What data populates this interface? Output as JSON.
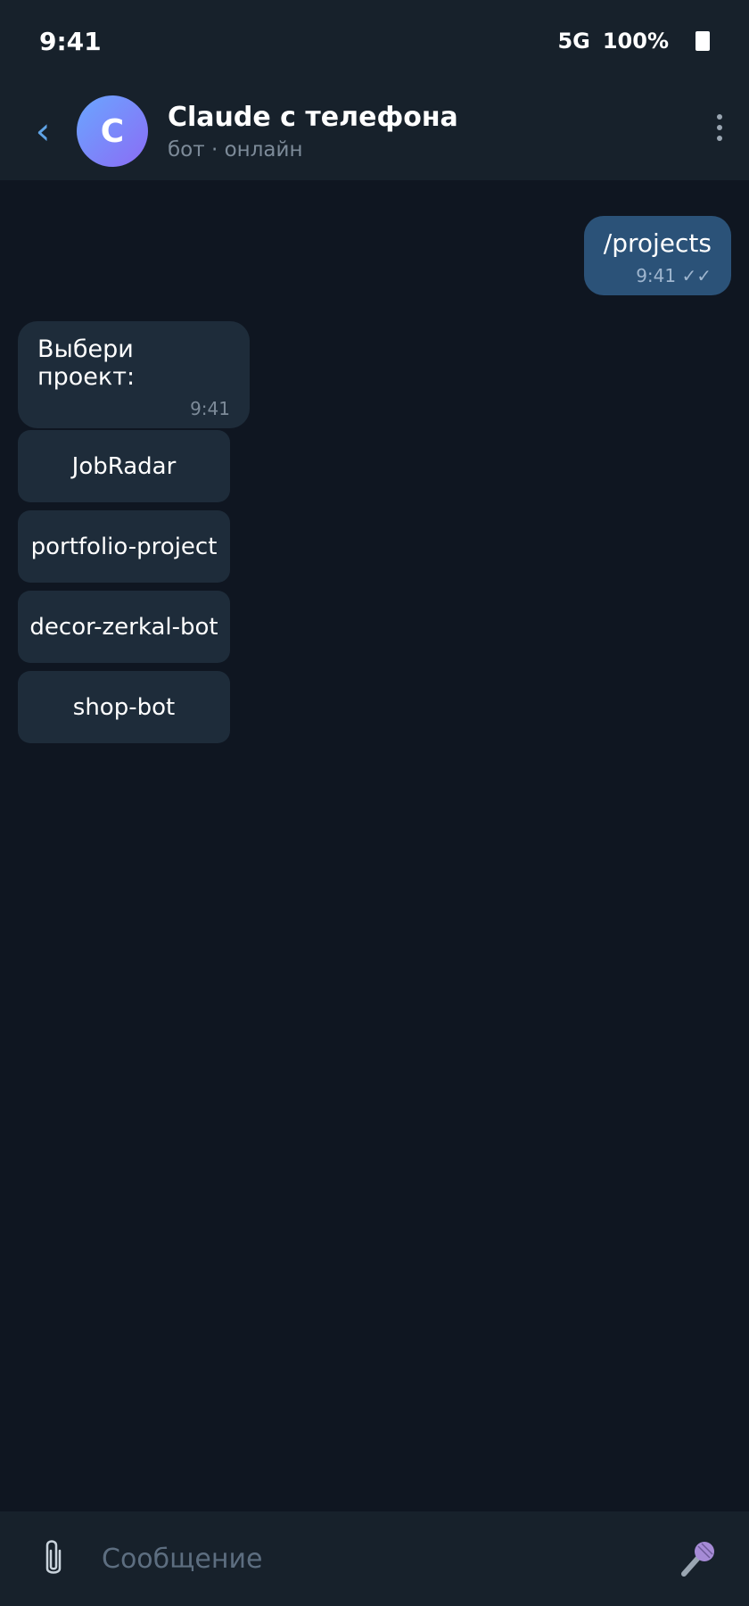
{
  "status_bar": {
    "time": "9:41",
    "network": "5G",
    "battery": "100%"
  },
  "header": {
    "avatar_letter": "C",
    "title": "Claude с телефона",
    "subtitle": "бот · онлайн"
  },
  "messages": {
    "outgoing": {
      "text": "/projects",
      "time": "9:41",
      "status": "✓✓"
    },
    "incoming": {
      "text": "Выбери проект:",
      "time": "9:41"
    }
  },
  "keyboard": {
    "buttons": [
      "JobRadar",
      "portfolio-project",
      "decor-zerkal-bot",
      "shop-bot"
    ]
  },
  "input": {
    "placeholder": "Сообщение"
  },
  "colors": {
    "background": "#0f1621",
    "header": "#17212b",
    "outgoing_bubble": "#2b5278",
    "incoming_bubble": "#1e2c3a",
    "accent": "#5fa3e6"
  },
  "icons": [
    "back-icon",
    "more-icon",
    "attach-icon",
    "mic-icon",
    "battery-icon"
  ]
}
